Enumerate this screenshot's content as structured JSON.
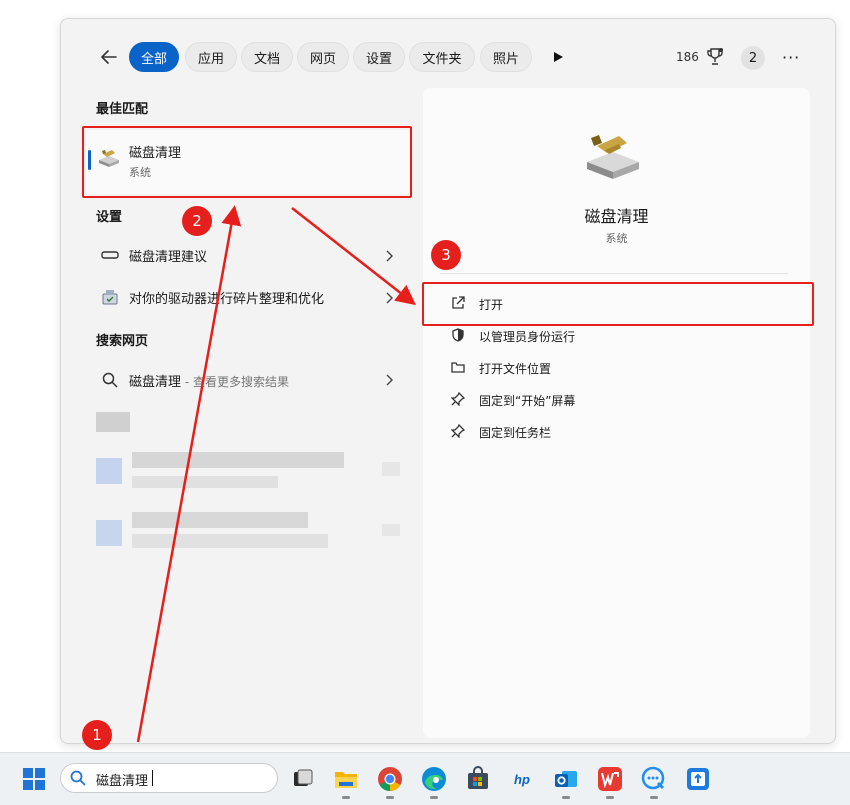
{
  "header": {
    "back_label": "←",
    "tabs": [
      {
        "label": "全部",
        "active": true
      },
      {
        "label": "应用"
      },
      {
        "label": "文档"
      },
      {
        "label": "网页"
      },
      {
        "label": "设置"
      },
      {
        "label": "文件夹"
      },
      {
        "label": "照片"
      }
    ],
    "points": "186",
    "badge_count": "2",
    "more_label": "···"
  },
  "results": {
    "best_match_heading": "最佳匹配",
    "best_match": {
      "title": "磁盘清理",
      "subtitle": "系统",
      "icon": "disk-cleanup-icon"
    },
    "settings_heading": "设置",
    "settings_items": [
      {
        "label": "磁盘清理建议",
        "icon": "storage-icon"
      },
      {
        "label": "对你的驱动器进行碎片整理和优化",
        "icon": "defrag-icon"
      }
    ],
    "web_heading": "搜索网页",
    "web_item": {
      "query": "磁盘清理",
      "suffix": " - 查看更多搜索结果",
      "icon": "search-icon"
    }
  },
  "detail": {
    "title": "磁盘清理",
    "subtitle": "系统",
    "actions": [
      {
        "label": "打开",
        "icon": "open-external-icon"
      },
      {
        "label": "以管理员身份运行",
        "icon": "shield-icon"
      },
      {
        "label": "打开文件位置",
        "icon": "folder-icon"
      },
      {
        "label": "固定到“开始”屏幕",
        "icon": "pin-icon"
      },
      {
        "label": "固定到任务栏",
        "icon": "pin-icon"
      }
    ]
  },
  "annotations": [
    "1",
    "2",
    "3"
  ],
  "taskbar": {
    "search_value": "磁盘清理",
    "apps": [
      "task-view-icon",
      "file-explorer-icon",
      "chrome-icon",
      "edge-icon",
      "store-icon",
      "hp-icon",
      "outlook-icon",
      "wps-icon",
      "chat-icon",
      "app-icon"
    ]
  },
  "colors": {
    "accent": "#0a63c6",
    "annotation": "#e5201c",
    "panel": "#f3f3f3"
  }
}
